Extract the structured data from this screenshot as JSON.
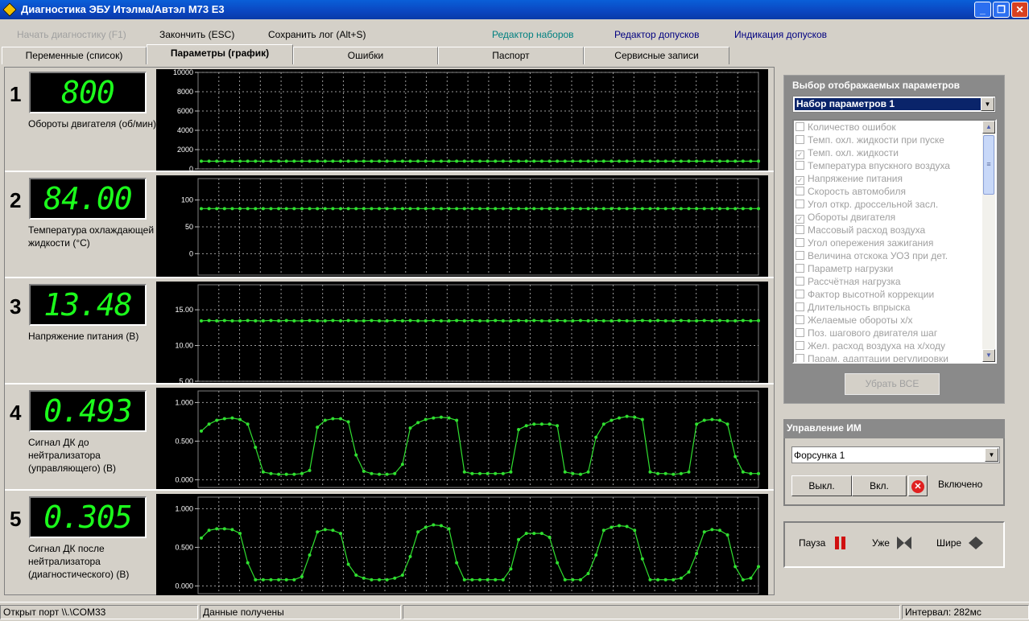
{
  "window": {
    "title": "Диагностика ЭБУ Итэлма/Автэл М73 Е3"
  },
  "menu": {
    "start": "Начать диагностику (F1)",
    "stop": "Закончить (ESC)",
    "save": "Сохранить лог (Alt+S)",
    "sets_editor": "Редактор наборов",
    "tolerance_editor": "Редактор допусков",
    "tolerance_indication": "Индикация допусков"
  },
  "tabs": [
    "Переменные (список)",
    "Параметры (график)",
    "Ошибки",
    "Паспорт",
    "Сервисные записи"
  ],
  "active_tab": "Параметры (график)",
  "graphs": [
    {
      "num": "1",
      "value": "800",
      "name": "Обороты двигателя (об/мин)",
      "yticks": [
        "10000",
        "8000",
        "6000",
        "4000",
        "2000",
        "0"
      ],
      "ylim": [
        0,
        10000
      ]
    },
    {
      "num": "2",
      "value": "84.00",
      "name": "Температура охлаждающей жидкости (°С)",
      "yticks": [
        "100",
        "50",
        "0"
      ],
      "ylim": [
        -40,
        140
      ]
    },
    {
      "num": "3",
      "value": "13.48",
      "name": "Напряжение питания (В)",
      "yticks": [
        "15.00",
        "10.00",
        "5.00"
      ],
      "ylim": [
        5,
        18.5
      ]
    },
    {
      "num": "4",
      "value": "0.493",
      "name": "Сигнал ДК до нейтрализатора (управляющего) (В)",
      "yticks": [
        "1.000",
        "0.500",
        "0.000"
      ],
      "ylim": [
        -0.1,
        1.15
      ]
    },
    {
      "num": "5",
      "value": "0.305",
      "name": "Сигнал ДК после нейтрализатора (диагностического) (В)",
      "yticks": [
        "1.000",
        "0.500",
        "0.000"
      ],
      "ylim": [
        -0.1,
        1.15
      ]
    }
  ],
  "chart_data": [
    {
      "type": "line",
      "values": [
        800,
        800,
        800,
        800,
        800,
        800,
        800,
        800,
        800,
        800,
        800,
        800,
        800,
        800,
        800,
        800,
        800,
        800,
        800,
        800,
        800,
        800,
        800,
        800,
        800,
        800,
        800,
        800,
        800,
        800,
        800,
        800,
        800,
        800,
        800,
        800,
        800,
        800,
        800,
        800,
        800,
        800,
        800,
        800,
        800,
        800,
        800,
        800,
        800,
        800,
        800,
        800,
        800,
        800,
        800,
        800,
        800,
        800,
        800,
        800,
        800,
        800,
        800,
        800,
        800,
        800,
        800,
        800,
        800,
        800,
        800,
        800,
        800
      ],
      "ylim": [
        0,
        10000
      ],
      "color": "#30e030"
    },
    {
      "type": "line",
      "values": [
        84,
        84,
        84,
        84,
        84,
        84,
        84,
        84,
        84,
        84,
        84,
        84,
        84,
        84,
        84,
        84,
        84,
        84,
        84,
        84,
        84,
        84,
        84,
        84,
        84,
        84,
        84,
        84,
        84,
        84,
        84,
        84,
        84,
        84,
        84,
        84,
        84,
        84,
        84,
        84,
        84,
        84,
        84,
        84,
        84,
        84,
        84,
        84,
        84,
        84,
        84,
        84,
        84,
        84,
        84,
        84,
        84,
        84,
        84,
        84,
        84,
        84,
        84,
        84,
        84,
        84,
        84,
        84,
        84,
        84,
        84,
        84,
        84
      ],
      "ylim": [
        -40,
        140
      ],
      "color": "#30e030"
    },
    {
      "type": "line",
      "values": [
        13.45,
        13.5,
        13.45,
        13.5,
        13.45,
        13.45,
        13.5,
        13.45,
        13.45,
        13.5,
        13.45,
        13.5,
        13.45,
        13.45,
        13.5,
        13.45,
        13.45,
        13.5,
        13.45,
        13.5,
        13.45,
        13.45,
        13.5,
        13.45,
        13.45,
        13.5,
        13.45,
        13.5,
        13.45,
        13.45,
        13.5,
        13.45,
        13.45,
        13.5,
        13.45,
        13.5,
        13.45,
        13.45,
        13.5,
        13.45,
        13.45,
        13.5,
        13.45,
        13.5,
        13.45,
        13.45,
        13.5,
        13.45,
        13.45,
        13.5,
        13.45,
        13.5,
        13.45,
        13.45,
        13.5,
        13.45,
        13.45,
        13.5,
        13.45,
        13.5,
        13.45,
        13.45,
        13.5,
        13.45,
        13.45,
        13.5,
        13.45,
        13.5,
        13.45,
        13.45,
        13.5,
        13.45,
        13.48
      ],
      "ylim": [
        5,
        18.5
      ],
      "color": "#30e030"
    },
    {
      "type": "line",
      "values": [
        0.63,
        0.72,
        0.77,
        0.79,
        0.8,
        0.78,
        0.72,
        0.42,
        0.1,
        0.08,
        0.07,
        0.07,
        0.07,
        0.08,
        0.12,
        0.68,
        0.77,
        0.79,
        0.79,
        0.75,
        0.32,
        0.11,
        0.08,
        0.07,
        0.07,
        0.08,
        0.2,
        0.67,
        0.74,
        0.78,
        0.8,
        0.81,
        0.8,
        0.77,
        0.1,
        0.08,
        0.08,
        0.08,
        0.08,
        0.08,
        0.1,
        0.65,
        0.7,
        0.72,
        0.72,
        0.72,
        0.7,
        0.1,
        0.08,
        0.07,
        0.1,
        0.55,
        0.72,
        0.77,
        0.8,
        0.82,
        0.81,
        0.78,
        0.1,
        0.08,
        0.08,
        0.07,
        0.08,
        0.1,
        0.72,
        0.77,
        0.78,
        0.77,
        0.72,
        0.3,
        0.1,
        0.08,
        0.08
      ],
      "ylim": [
        -0.1,
        1.15
      ],
      "color": "#30e030"
    },
    {
      "type": "line",
      "values": [
        0.62,
        0.72,
        0.74,
        0.74,
        0.73,
        0.68,
        0.3,
        0.08,
        0.08,
        0.08,
        0.08,
        0.08,
        0.08,
        0.12,
        0.4,
        0.7,
        0.73,
        0.72,
        0.68,
        0.28,
        0.14,
        0.1,
        0.08,
        0.08,
        0.08,
        0.1,
        0.14,
        0.38,
        0.7,
        0.76,
        0.79,
        0.78,
        0.74,
        0.3,
        0.08,
        0.08,
        0.08,
        0.08,
        0.08,
        0.08,
        0.22,
        0.6,
        0.68,
        0.68,
        0.68,
        0.63,
        0.3,
        0.08,
        0.08,
        0.08,
        0.16,
        0.4,
        0.72,
        0.76,
        0.78,
        0.77,
        0.72,
        0.35,
        0.08,
        0.08,
        0.08,
        0.08,
        0.1,
        0.18,
        0.42,
        0.7,
        0.73,
        0.72,
        0.66,
        0.25,
        0.08,
        0.1,
        0.25
      ],
      "ylim": [
        -0.1,
        1.15
      ],
      "color": "#30e030"
    }
  ],
  "right": {
    "header": "Выбор отображаемых параметров",
    "set_value": "Набор параметров 1",
    "params": [
      {
        "label": "Количество ошибок",
        "checked": false
      },
      {
        "label": "Темп. охл. жидкости при пуске",
        "checked": false
      },
      {
        "label": "Темп. охл. жидкости",
        "checked": true
      },
      {
        "label": "Температура впускного воздуха",
        "checked": false
      },
      {
        "label": "Напряжение питания",
        "checked": true
      },
      {
        "label": "Скорость автомобиля",
        "checked": false
      },
      {
        "label": "Угол откр. дроссельной засл.",
        "checked": false
      },
      {
        "label": "Обороты двигателя",
        "checked": true
      },
      {
        "label": "Массовый расход воздуха",
        "checked": false
      },
      {
        "label": "Угол опережения зажигания",
        "checked": false
      },
      {
        "label": "Величина отскока УОЗ при дет.",
        "checked": false
      },
      {
        "label": "Параметр нагрузки",
        "checked": false
      },
      {
        "label": "Рассчётная нагрузка",
        "checked": false
      },
      {
        "label": "Фактор высотной коррекции",
        "checked": false
      },
      {
        "label": "Длительность впрыска",
        "checked": false
      },
      {
        "label": "Желаемые обороты х/х",
        "checked": false
      },
      {
        "label": "Поз. шагового двигателя шаг",
        "checked": false
      },
      {
        "label": "Жел. расход воздуха на х/ходу",
        "checked": false
      },
      {
        "label": "Парам. адаптации регулировки",
        "checked": false
      }
    ],
    "remove_all": "Убрать ВСЕ"
  },
  "im": {
    "header": "Управление ИМ",
    "device": "Форсунка 1",
    "off": "Выкл.",
    "on": "Вкл.",
    "state": "Включено"
  },
  "controls": {
    "pause": "Пауза",
    "narrow": "Уже",
    "wide": "Шире"
  },
  "status": {
    "port": "Открыт порт \\\\.\\COM33",
    "data": "Данные получены",
    "interval": "Интервал: 282мс"
  }
}
